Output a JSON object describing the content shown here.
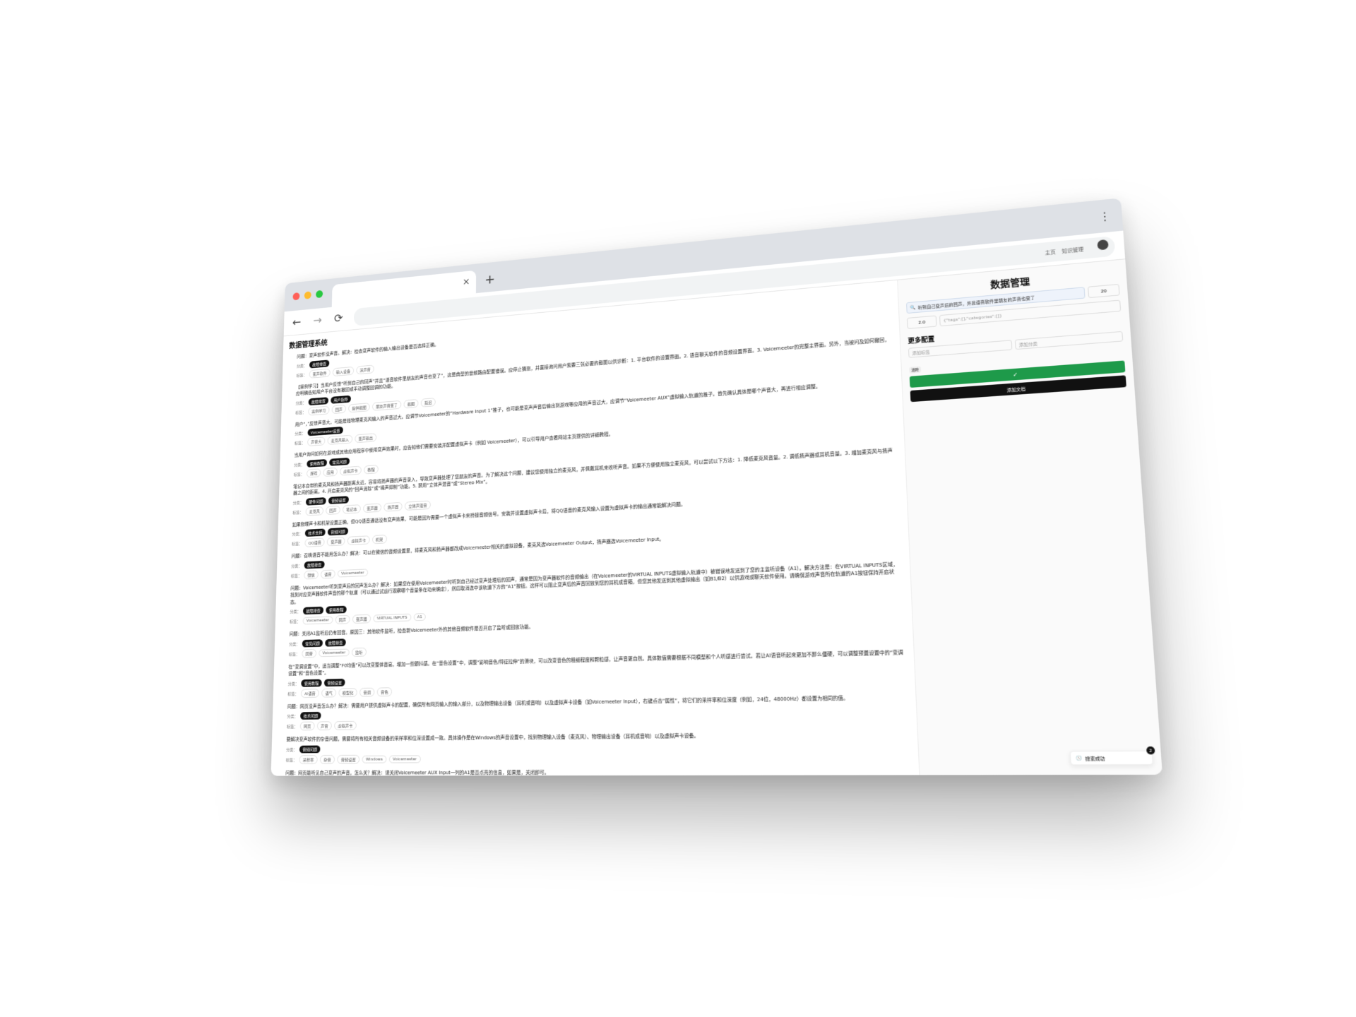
{
  "browser": {
    "tab_close": "×",
    "new_tab": "+",
    "menu": "⋮",
    "back": "←",
    "forward": "→",
    "reload": "⟳",
    "top_links": [
      "主页",
      "知识管理"
    ]
  },
  "app": {
    "brand": "数据管理系统"
  },
  "items": [
    {
      "q": "问题：变声软件没声音。解决：检查变声软件的输入输出设备是否选择正确。",
      "cats": [
        "故障排查"
      ],
      "tags": [
        "变声软件",
        "输入设备",
        "没声音"
      ]
    },
    {
      "q": "【案例学习】当用户反馈“听到自己的回声”并且“语音软件里朋友的声音也变了”，这是典型的音频路由配置错误。应停止猜测，并直接询问用户索要三张必要的截图以供诊断：1. 平台软件的设置界面。2. 语音聊天软件的音频设置界面。3. Voicemeeter的完整主界面。另外，当被问及如何撤回，应明确告知用户平台没有撤回或手动调整回调的功能。",
      "cats": [
        "故障排查",
        "用户指导"
      ],
      "tags": [
        "案例学习",
        "回声",
        "提供截图",
        "朋友声音变了",
        "截图",
        "延迟"
      ]
    },
    {
      "q": "用户“，”反馈声音大，可能是指物理麦克风输入的声音过大。应调节Voicemeeter的“Hardware Input 1”推子，也可能是变声声音后输出到游戏等应用的声音过大，应调节“Voicemeeter AUX”虚拟输入轨道的推子。首先确认具体是哪个声音大，再进行相应调整。",
      "cats": [
        "Voicemeeter设置"
      ],
      "tags": [
        "声音大",
        "麦克风输入",
        "变声输出"
      ]
    },
    {
      "q": "当用户询问如何在游戏或其他应用程序中使用变声效果时，应告知他们需要安装并配置虚拟声卡（例如 Voicemeeter），可以引导用户查看网站主页提供的详细教程。",
      "cats": [
        "使用教程",
        "常见问题"
      ],
      "tags": [
        "游戏",
        "应用",
        "虚拟声卡",
        "教程"
      ]
    },
    {
      "q": "笔记本自带的麦克风和扬声器距离太近，容易将扬声器的声音录入，导致变声器处理了您朋友的声音。为了解决这个问题，建议您使用独立的麦克风，并佩戴耳机来收听声音。如果不方便使用独立麦克风，可以尝试以下方法：1. 降低麦克风音量。2. 调低扬声器或耳机音量。3. 增加麦克风与扬声器之间的距离。4. 开启麦克风的“回声消除”或“噪声抑制”功能。5. 禁用“立体声混音”或“Stereo Mix”。",
      "cats": [
        "硬件问题",
        "音频设置"
      ],
      "tags": [
        "麦克风",
        "回声",
        "笔记本",
        "变声器",
        "扬声器",
        "立体声混音"
      ]
    },
    {
      "q": "如果物理声卡和机架设置正确，但QQ语音通话没有变声效果，可能是因为需要一个虚拟声卡来桥接音频信号。安装并设置虚拟声卡后，将QQ语音的麦克风输入设置为虚拟声卡的输出通常能解决问题。",
      "cats": [
        "技术支持",
        "音频问题"
      ],
      "tags": [
        "QQ语音",
        "变声器",
        "虚拟声卡",
        "机架"
      ]
    },
    {
      "q": "问题：召唤语音不能用怎么办？解决：可以在微信的音频设置里，将麦克风和扬声器都改成Voicemeeter相关的虚拟设备，麦克风选Voicemeeter Output，扬声器选Voicemeeter Input。",
      "cats": [
        "故障排查"
      ],
      "tags": [
        "微信",
        "语音",
        "Voicemeeter"
      ]
    },
    {
      "q": "问题：Voicemeeter听到变声后的回声怎么办？解决：如果您在使用Voicemeeter时听到自己经过变声处理后的回声，通常是因为变声器软件的音频输出（在Voicemeeter的VIRTUAL INPUTS虚拟输入轨道中）被错误地发送到了您的主监听设备（A1）。解决方法是：在VIRTUAL INPUTS区域，找到对应变声器软件声音的那个轨道（可以通过试运行观察哪个音量条在动来确定），然后取消选中该轨道下方的“A1”按钮。这样可以阻止变声后的声音回放到您的耳机或音箱，但您其他发送到其他虚拟输出（如B1/B2）以供游戏或聊天软件使用。请确保游戏声音所在轨道的A1按钮保持开启状态。",
      "cats": [
        "故障排查",
        "使用教程"
      ],
      "tags": [
        "Voicemeeter",
        "回声",
        "变声器",
        "VIRTUAL INPUTS",
        "A1"
      ]
    },
    {
      "q": "问题：关闭A1监听后仍有回音。原因三：其他软件监听，检查新Voicemeeter外的其他音频软件是否开启了监听或回放功能。",
      "cats": [
        "常见问题",
        "故障排查"
      ],
      "tags": [
        "回音",
        "Voicemeeter",
        "监听"
      ]
    },
    {
      "q": "在“变调设置”中，适当调整“F0均值”可以改变整体音高，增加一些颤抖感。在“音色设置”中，调整“影响音色/特征拉伸”的滑块，可以改变音色的粗细程度和颗粒感，让声音更自然。具体数值需要根据不同模型和个人听感进行尝试。若让AI语音听起来更加不那么僵硬，可以调整预置设置中的“变调设置”和“音色设置”。",
      "cats": [
        "使用教程",
        "音频设置"
      ],
      "tags": [
        "AI语音",
        "语气",
        "模型化",
        "音调",
        "音色"
      ]
    },
    {
      "q": "问题：网页没声音怎么办？解决：需要用户提供虚拟声卡的配置，确保所有网页输入的输入部分，以及物理输出设备（耳机或音响）以及虚拟声卡设备（如Voicemeeter Input），右键点击“属性”，将它们的采样率和位深度（例如，24位，48000Hz）都设置为相同的值。",
      "cats": [
        "技术问题"
      ],
      "tags": [
        "网页",
        "声音",
        "虚拟声卡"
      ]
    },
    {
      "q": "要解决变声软件的杂音问题，需要将所有相关音频设备的采样率和位深设置成一致。具体操作是在Windows的声音设置中，找到物理输入设备（麦克风）、物理输出设备（耳机或音响）以及虚拟声卡设备。",
      "cats": [
        "音频问题"
      ],
      "tags": [
        "采样率",
        "杂音",
        "音频设置",
        "Windows",
        "Voicemeeter"
      ]
    },
    {
      "q": "问题：网页能听见自己变声的声音，怎么关？解决：请关闭Voicemeeter AUX Input一列的A1是否点亮的信息，如果是，关闭即可。",
      "cats": [],
      "tags": []
    }
  ],
  "panel": {
    "title": "数据管理",
    "search_value": "听到自己变声后的回声，并且语音软件里朋友的声音也变了",
    "search_icon": "search-icon",
    "top_k": "20",
    "threshold": "2.0",
    "filter_placeholder": "{\"tags\":[],\"categories\":[]}",
    "more_title": "更多配置",
    "tag_placeholder": "添加标签",
    "cat_placeholder": "添加分类",
    "chip": "清除",
    "confirm_icon": "✓",
    "add_doc": "添加文档",
    "toast_text": "搜索成功",
    "toast_count": "2"
  },
  "labels": {
    "cat_prefix": "分类：",
    "tag_prefix": "标签："
  },
  "colors": {
    "green": "#1e9a4a",
    "black": "#111111"
  }
}
